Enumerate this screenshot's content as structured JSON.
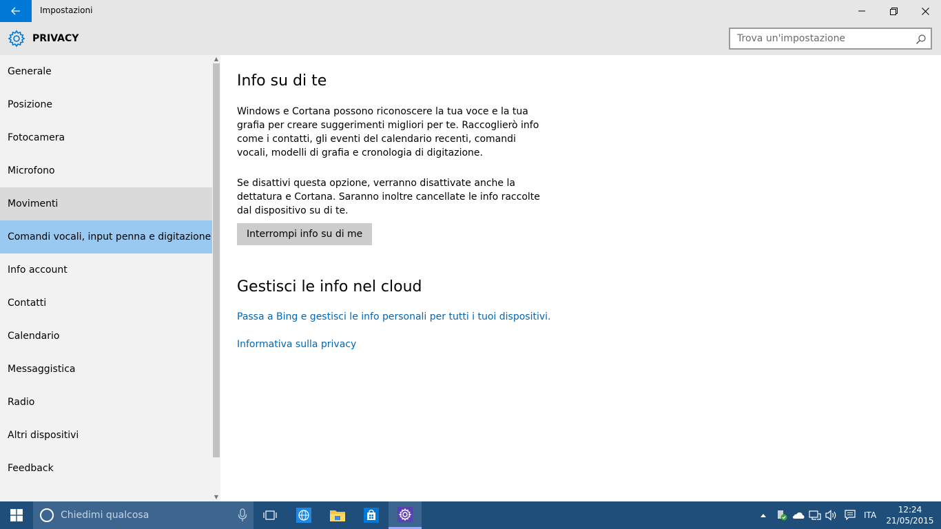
{
  "window": {
    "app_title": "Impostazioni",
    "section_title": "PRIVACY"
  },
  "search": {
    "placeholder": "Trova un'impostazione"
  },
  "sidebar": {
    "items": [
      {
        "label": "Generale"
      },
      {
        "label": "Posizione"
      },
      {
        "label": "Fotocamera"
      },
      {
        "label": "Microfono"
      },
      {
        "label": "Movimenti"
      },
      {
        "label": "Comandi vocali, input penna e digitazione"
      },
      {
        "label": "Info account"
      },
      {
        "label": "Contatti"
      },
      {
        "label": "Calendario"
      },
      {
        "label": "Messaggistica"
      },
      {
        "label": "Radio"
      },
      {
        "label": "Altri dispositivi"
      },
      {
        "label": "Feedback"
      }
    ],
    "selected_index": 5,
    "hover_index": 4
  },
  "main": {
    "heading": "Info su di te",
    "paragraph1": "Windows e Cortana possono riconoscere la tua voce e la tua grafia per creare suggerimenti migliori per te. Raccoglierò info come i contatti, gli eventi del calendario recenti, comandi vocali, modelli di grafia e cronologia di digitazione.",
    "paragraph2": "Se disattivi questa opzione, verranno disattivate anche la dettatura e Cortana. Saranno inoltre cancellate le info raccolte dal dispositivo su di te.",
    "button_label": "Interrompi info su di me",
    "heading2": "Gestisci le info nel cloud",
    "link1": "Passa a Bing e gestisci le info personali per tutti i tuoi dispositivi.",
    "link2": "Informativa sulla privacy"
  },
  "taskbar": {
    "cortana_placeholder": "Chiedimi qualcosa",
    "language": "ITA",
    "time": "12:24",
    "date": "21/05/2015"
  },
  "colors": {
    "accent": "#0078d7",
    "selected": "#99c9f0",
    "link": "#0067b8",
    "taskbar": "#1f4e7a"
  }
}
